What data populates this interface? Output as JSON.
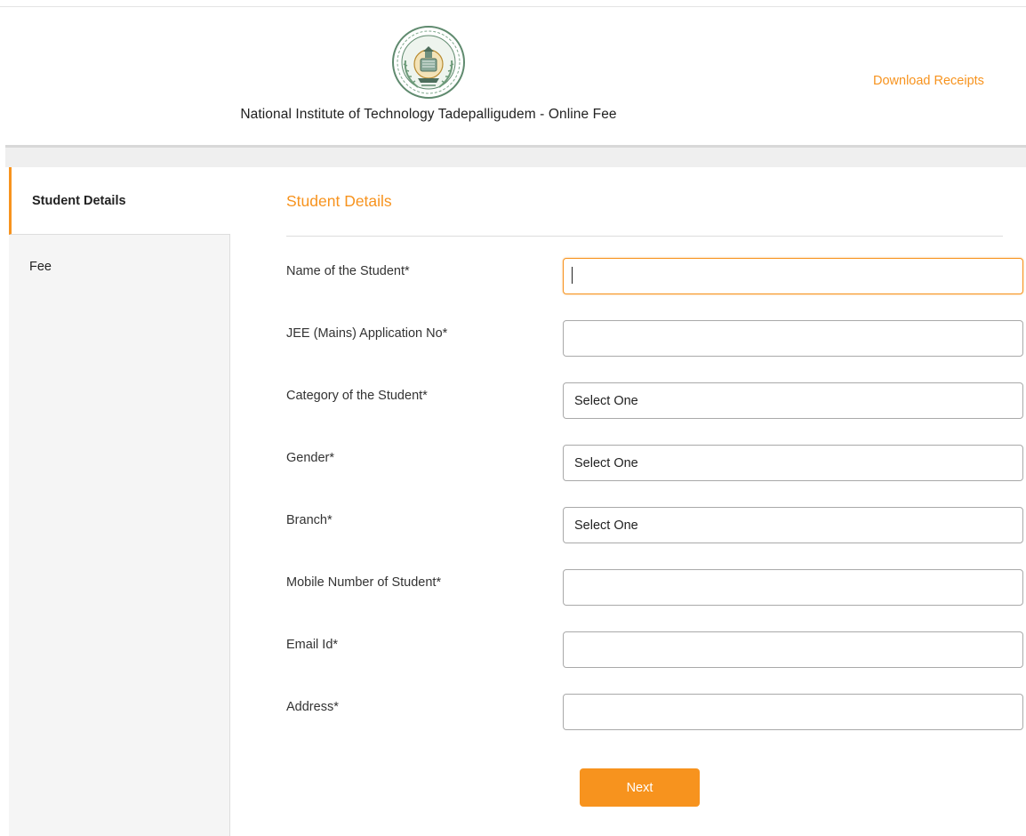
{
  "header": {
    "title": "National Institute of Technology Tadepalligudem - Online Fee",
    "download_link": "Download Receipts",
    "logo_icon": "institute-emblem-icon"
  },
  "sidebar": {
    "items": [
      {
        "label": "Student Details",
        "active": true
      },
      {
        "label": "Fee",
        "active": false
      }
    ]
  },
  "form": {
    "section_title": "Student Details",
    "fields": [
      {
        "label": "Name of the Student*",
        "value": "",
        "type": "text"
      },
      {
        "label": "JEE (Mains) Application No*",
        "value": "",
        "type": "text"
      },
      {
        "label": "Category of the Student*",
        "value": "Select One",
        "type": "select"
      },
      {
        "label": "Gender*",
        "value": "Select One",
        "type": "select"
      },
      {
        "label": "Branch*",
        "value": "Select One",
        "type": "select"
      },
      {
        "label": "Mobile Number of Student*",
        "value": "",
        "type": "text"
      },
      {
        "label": "Email Id*",
        "value": "",
        "type": "text"
      },
      {
        "label": "Address*",
        "value": "",
        "type": "text"
      }
    ],
    "next_label": "Next"
  },
  "colors": {
    "accent": "#f7931e",
    "sidebar_bg": "#f5f5f5",
    "border": "#a9a9a9"
  }
}
